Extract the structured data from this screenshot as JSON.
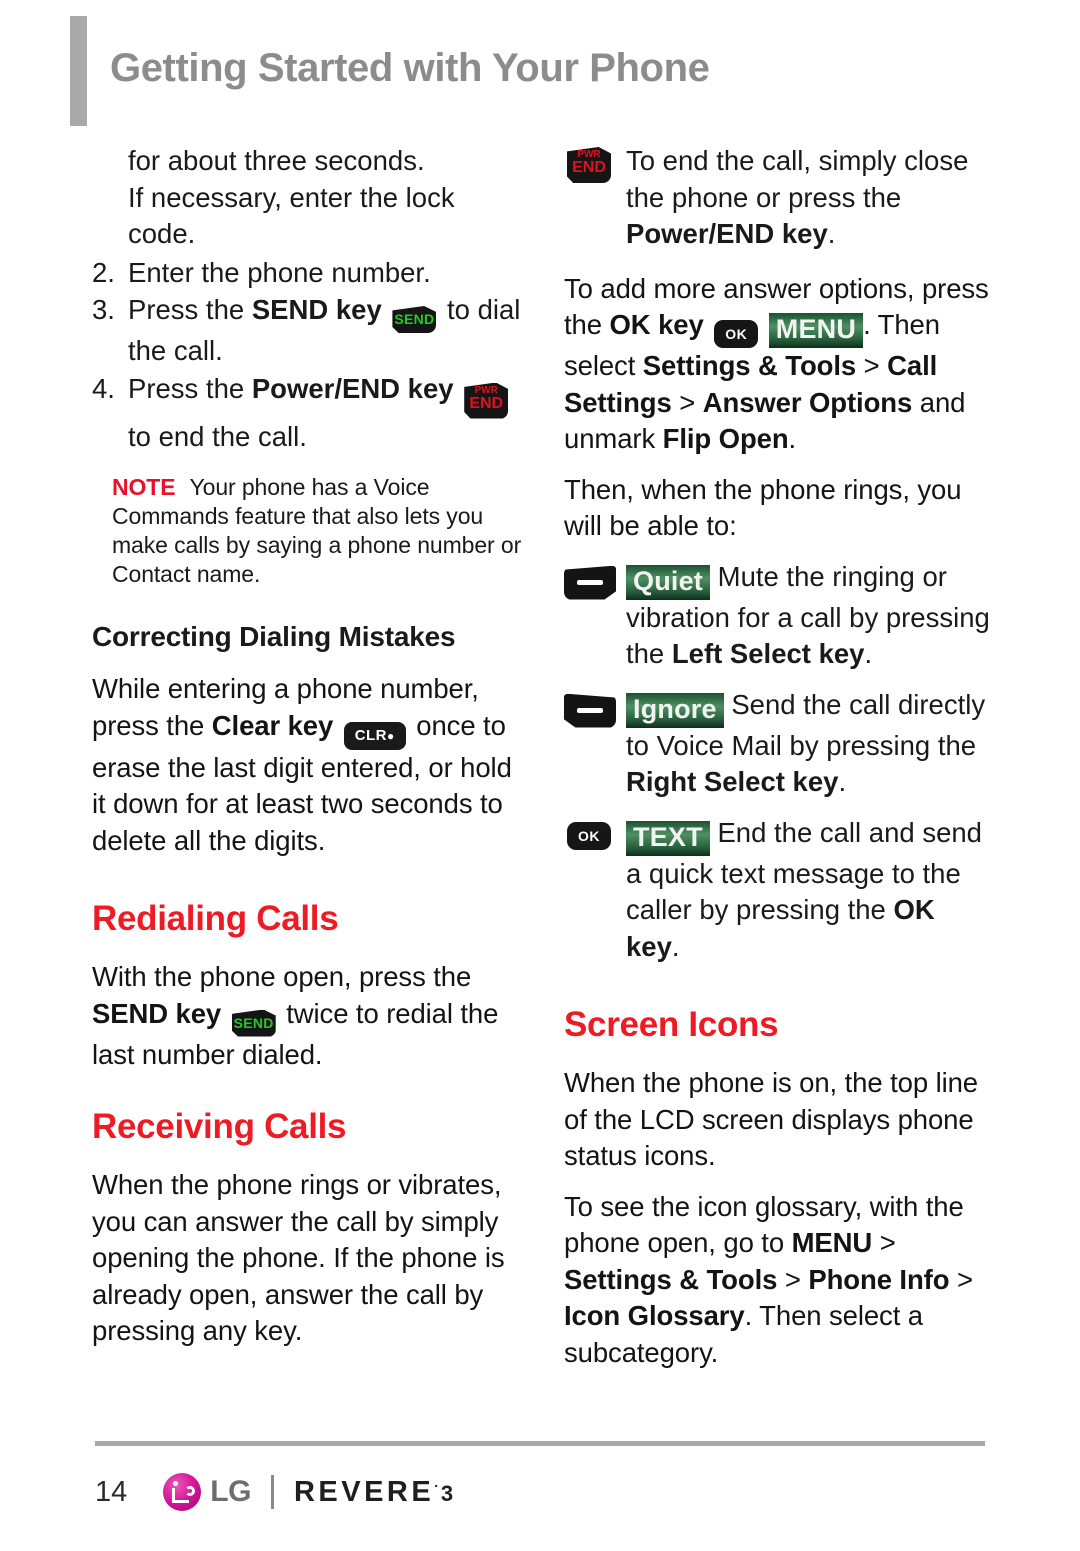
{
  "header": {
    "title": "Getting Started with Your Phone"
  },
  "colors": {
    "heading_red": "#ed1c24",
    "note_red": "#e8112d",
    "header_gray": "#8c8c8c",
    "rule_gray": "#a9a9a9",
    "lcd_green": "#4e8f63",
    "send_green": "#22cc22",
    "end_red": "#e01020",
    "lg_magenta": "#d6199b"
  },
  "left_column": {
    "continued_step": {
      "line1": "for about three seconds.",
      "line2": "If necessary, enter the lock",
      "line3": "code."
    },
    "steps": [
      {
        "num": "2.",
        "text": "Enter the phone number."
      },
      {
        "num": "3.",
        "pre": "Press the ",
        "bold": "SEND key",
        "icon": "send-key-icon",
        "post": " to dial the call."
      },
      {
        "num": "4.",
        "pre": "Press the ",
        "bold": "Power/END key",
        "icon": "power-end-key-icon",
        "post": " to end the call."
      }
    ],
    "note": {
      "label": "NOTE",
      "text": "Your phone has a Voice Commands feature that also lets you make calls by saying a phone number or Contact name."
    },
    "correcting_heading": "Correcting Dialing Mistakes",
    "correcting_body": {
      "pre": "While entering a phone number, press the ",
      "bold": "Clear key",
      "icon": "clear-key-icon",
      "post": " once to erase the last digit entered, or hold it down for at least two seconds to delete all the digits."
    },
    "redialing_heading": "Redialing Calls",
    "redialing_body": {
      "pre": "With the phone open, press the ",
      "bold": "SEND key",
      "icon": "send-key-icon",
      "post": " twice to redial the last number dialed."
    },
    "receiving_heading": "Receiving Calls",
    "receiving_body": "When the phone rings or vibrates, you can answer the call by simply opening the phone. If the phone is already open, answer the call by pressing any key."
  },
  "right_column": {
    "end_call": {
      "icon": "power-end-key-icon",
      "pre": "To end the call, simply close the phone or press the ",
      "bold": "Power/END key",
      "post": "."
    },
    "answer_options": {
      "pre": "To add more answer options, press the ",
      "bold_ok": "OK key",
      "ok_icon": "ok-key-icon",
      "menu_badge": "MENU",
      "mid": ". Then select ",
      "bold1": "Settings & Tools",
      "sep1": " > ",
      "bold2": "Call Settings",
      "sep2": " > ",
      "bold3": "Answer Options",
      "mid2": " and unmark ",
      "bold4": "Flip Open",
      "end": "."
    },
    "then_line": "Then, when the phone rings, you will be able to:",
    "options": [
      {
        "icon": "left-select-key-icon",
        "badge": "Quiet",
        "pre": " Mute the ringing or vibration for a call by pressing the ",
        "bold": "Left Select key",
        "post": "."
      },
      {
        "icon": "right-select-key-icon",
        "badge": "Ignore",
        "pre": " Send the call directly to Voice Mail by pressing the ",
        "bold": "Right Select key",
        "post": "."
      },
      {
        "icon": "ok-key-icon",
        "badge": "TEXT",
        "pre": " End the call and send a quick text message to the caller by pressing the ",
        "bold": "OK key",
        "post": "."
      }
    ],
    "screen_icons_heading": "Screen Icons",
    "screen_icons_body": "When the phone is on, the top line of the LCD screen displays phone status icons.",
    "glossary": {
      "pre": "To see the icon glossary, with the phone open, go to ",
      "bold_menu": "MENU",
      "sep1": " > ",
      "bold1": "Settings & Tools",
      "sep2": " > ",
      "bold2": "Phone Info",
      "sep3": " > ",
      "bold3": "Icon Glossary",
      "post": ". Then select a subcategory."
    }
  },
  "footer": {
    "page_number": "14",
    "lg_wordmark": "LG",
    "product_name": "REVERE",
    "product_trademark": "·",
    "product_version": "3"
  },
  "key_labels": {
    "send": "SEND",
    "pwr": "PWR",
    "end": "END",
    "clr": "CLR",
    "ok": "OK"
  }
}
